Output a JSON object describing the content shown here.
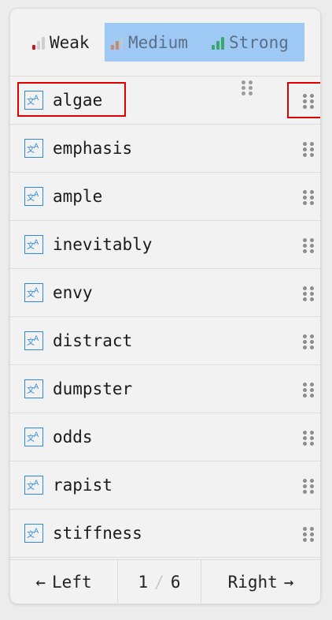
{
  "filters": {
    "weak": {
      "label": "Weak",
      "bar_color": "#d0121b"
    },
    "medium": {
      "label": "Medium",
      "bar_color": "#c98a67"
    },
    "strong": {
      "label": "Strong",
      "bar_color": "#3aa86a"
    },
    "selected_background": "#9ec9f5"
  },
  "words": [
    {
      "word": "algae",
      "icon": "translate-icon"
    },
    {
      "word": "emphasis",
      "icon": "translate-icon"
    },
    {
      "word": "ample",
      "icon": "translate-icon"
    },
    {
      "word": "inevitably",
      "icon": "translate-icon"
    },
    {
      "word": "envy",
      "icon": "translate-icon"
    },
    {
      "word": "distract",
      "icon": "translate-icon"
    },
    {
      "word": "dumpster",
      "icon": "translate-icon"
    },
    {
      "word": "odds",
      "icon": "translate-icon"
    },
    {
      "word": "rapist",
      "icon": "translate-icon"
    },
    {
      "word": "stiffness",
      "icon": "translate-icon"
    }
  ],
  "pager": {
    "left_label": "Left",
    "left_arrow": "←",
    "current": "1",
    "separator": "/",
    "total": "6",
    "right_label": "Right",
    "right_arrow": "→"
  },
  "colors": {
    "accent_blue": "#2d8ad6",
    "highlight_red": "#e00000"
  }
}
